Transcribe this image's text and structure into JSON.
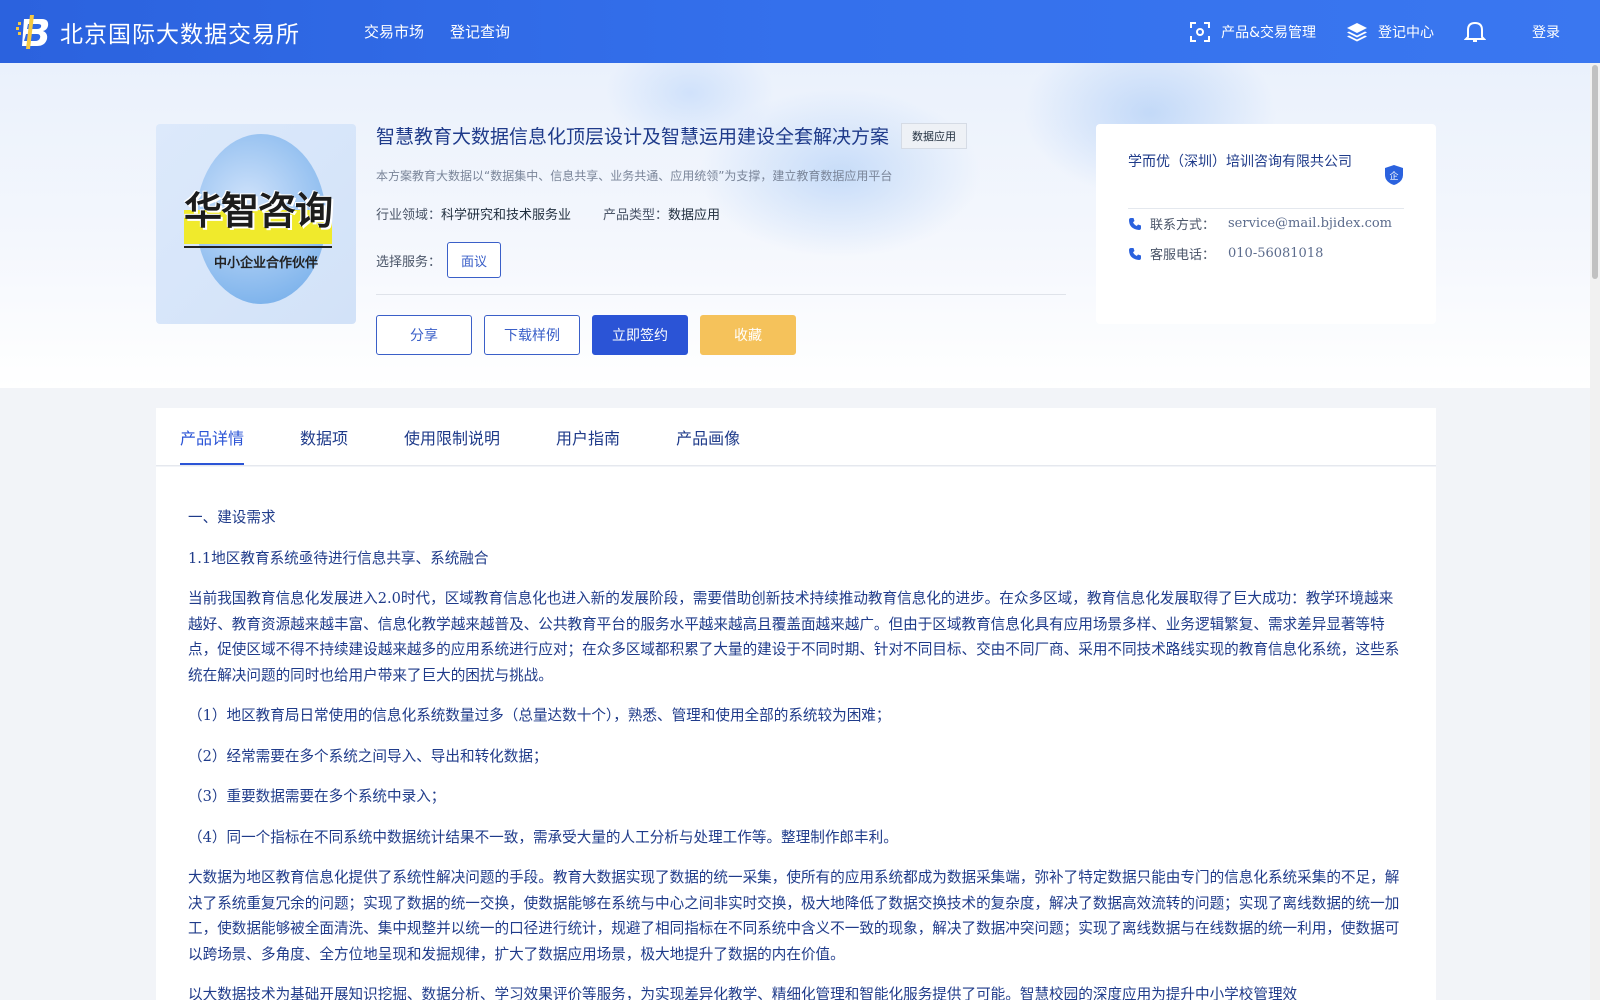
{
  "header": {
    "site_name": "北京国际大数据交易所",
    "nav": [
      "交易市场",
      "登记查询"
    ],
    "right": {
      "product_mgmt": "产品&交易管理",
      "register_center": "登记中心",
      "login": "登录"
    }
  },
  "product": {
    "image_brand": "华智咨询",
    "image_sub": "中小企业合作伙伴",
    "title": "智慧教育大数据信息化顶层设计及智慧运用建设全套解决方案",
    "tag": "数据应用",
    "description": "本方案教育大数据以“数据集中、信息共享、业务共通、应用统领”为支撑，建立教育数据应用平台",
    "industry_label": "行业领域：",
    "industry_value": "科学研究和技术服务业",
    "type_label": "产品类型：",
    "type_value": "数据应用",
    "service_label": "选择服务：",
    "service_option": "面议",
    "buttons": {
      "share": "分享",
      "download": "下载样例",
      "sign": "立即签约",
      "favorite": "收藏"
    }
  },
  "company": {
    "name": "学而优（深圳）培训咨询有限共公司",
    "badge": "企",
    "contact_label": "联系方式：",
    "contact_value": "service@mail.bjidex.com",
    "phone_label": "客服电话：",
    "phone_value": "010-56081018"
  },
  "tabs": [
    "产品详情",
    "数据项",
    "使用限制说明",
    "用户指南",
    "产品画像"
  ],
  "content": {
    "paragraphs": [
      "一、建设需求",
      "1.1地区教育系统亟待进行信息共享、系统融合",
      "当前我国教育信息化发展进入2.0时代，区域教育信息化也进入新的发展阶段，需要借助创新技术持续推动教育信息化的进步。在众多区域，教育信息化发展取得了巨大成功：教学环境越来越好、教育资源越来越丰富、信息化教学越来越普及、公共教育平台的服务水平越来越高且覆盖面越来越广。但由于区域教育信息化具有应用场景多样、业务逻辑繁复、需求差异显著等特点，促使区域不得不持续建设越来越多的应用系统进行应对；在众多区域都积累了大量的建设于不同时期、针对不同目标、交由不同厂商、采用不同技术路线实现的教育信息化系统，这些系统在解决问题的同时也给用户带来了巨大的困扰与挑战。",
      "（1）地区教育局日常使用的信息化系统数量过多（总量达数十个），熟悉、管理和使用全部的系统较为困难；",
      "（2）经常需要在多个系统之间导入、导出和转化数据；",
      "（3）重要数据需要在多个系统中录入；",
      "（4）同一个指标在不同系统中数据统计结果不一致，需承受大量的人工分析与处理工作等。整理制作郎丰利。",
      "大数据为地区教育信息化提供了系统性解决问题的手段。教育大数据实现了数据的统一采集，使所有的应用系统都成为数据采集端，弥补了特定数据只能由专门的信息化系统采集的不足，解决了系统重复冗余的问题；实现了数据的统一交换，使数据能够在系统与中心之间非实时交换，极大地降低了数据交换技术的复杂度，解决了数据高效流转的问题；实现了离线数据的统一加工，使数据能够被全面清洗、集中规整并以统一的口径进行统计，规避了相同指标在不同系统中含义不一致的现象，解决了数据冲突问题；实现了离线数据与在线数据的统一利用，使数据可以跨场景、多角度、全方位地呈现和发掘规律，扩大了数据应用场景，极大地提升了数据的内在价值。",
      "以大数据技术为基础开展知识挖掘、数据分析、学习效果评价等服务，为实现差异化教学、精细化管理和智能化服务提供了可能。智慧校园的深度应用为提升中小学校管理效"
    ]
  }
}
